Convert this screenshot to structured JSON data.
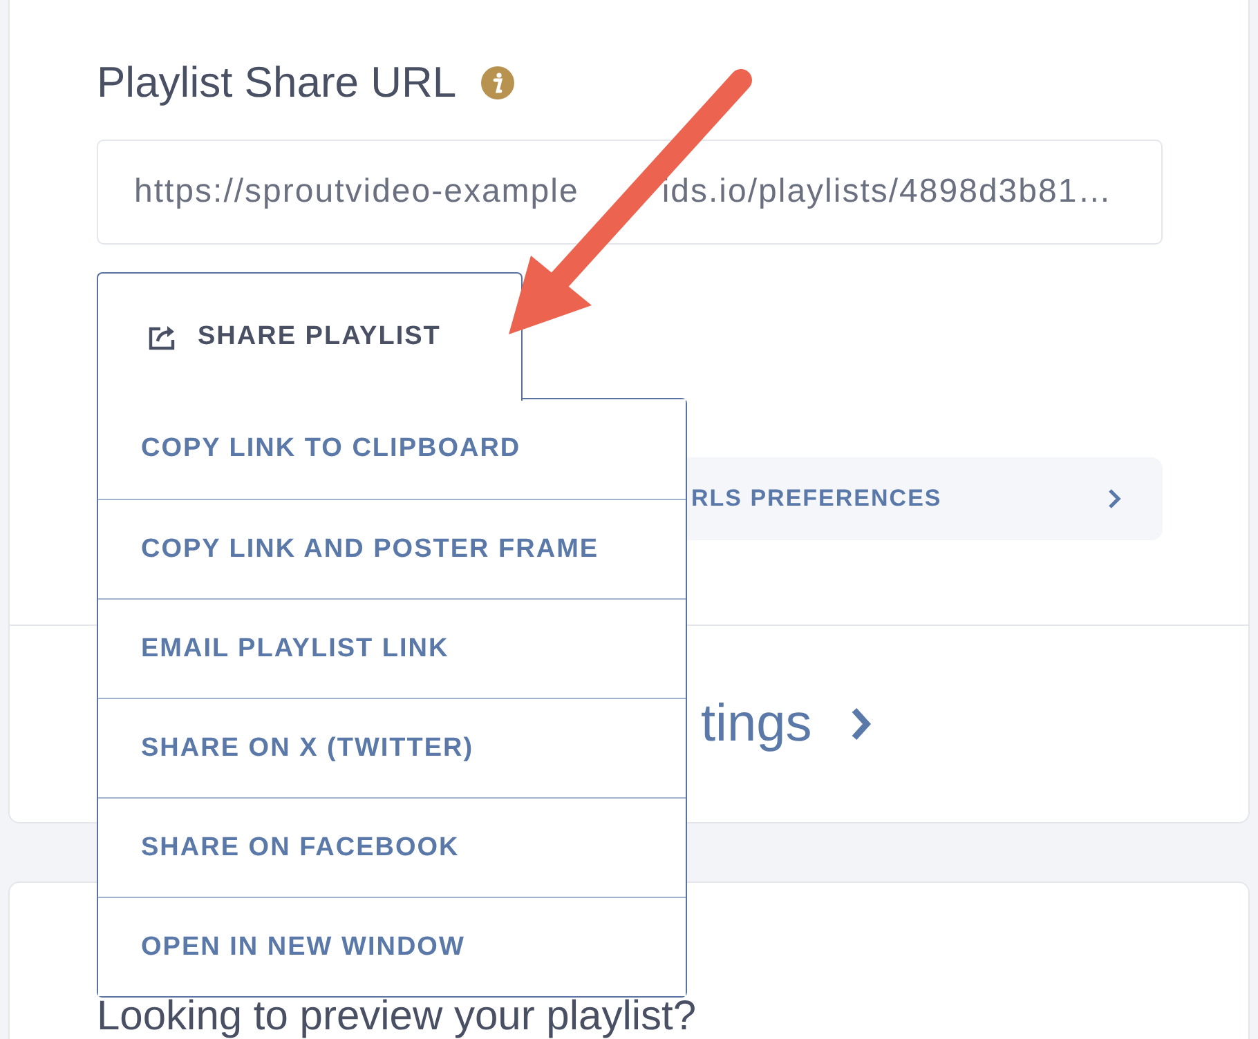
{
  "share_url": {
    "label": "Playlist Share URL",
    "value_parts": [
      "https://sproutvideo-example",
      "ids.io/playlists/4898d3b81…"
    ]
  },
  "share_button": {
    "label": "SHARE PLAYLIST",
    "expanded": true
  },
  "share_menu": [
    {
      "label": "COPY LINK TO CLIPBOARD"
    },
    {
      "label": "COPY LINK AND POSTER FRAME"
    },
    {
      "label": "EMAIL PLAYLIST LINK"
    },
    {
      "label": "SHARE ON X (TWITTER)"
    },
    {
      "label": "SHARE ON FACEBOOK"
    },
    {
      "label": "OPEN IN NEW WINDOW"
    }
  ],
  "preferences_button": {
    "label": "RLS PREFERENCES"
  },
  "settings_link": {
    "label": "tings"
  },
  "preview_heading": "Looking to preview your playlist?"
}
